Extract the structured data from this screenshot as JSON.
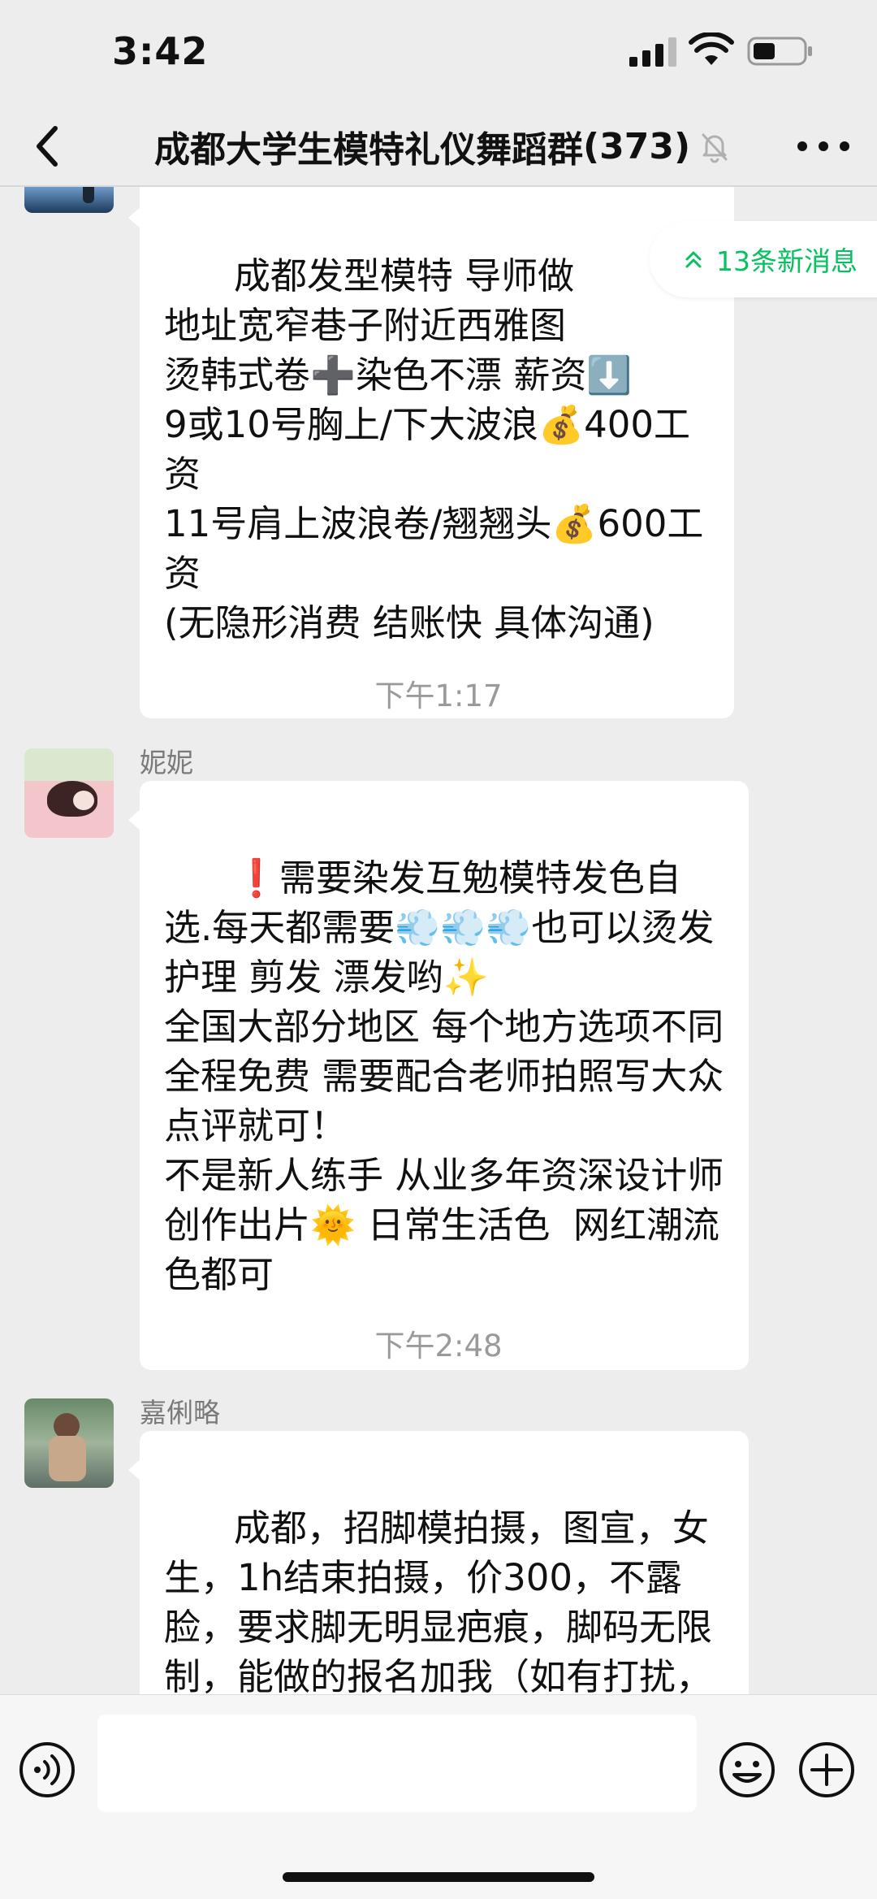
{
  "status_bar": {
    "time": "3:42"
  },
  "header": {
    "back_icon": "chevron-left-icon",
    "title": "成都大学生模特礼仪舞蹈群",
    "member_count": "(373)",
    "mute_icon": "bell-off-icon",
    "more_icon": "more-dots-icon"
  },
  "new_messages_pill": {
    "label": "13条新消息",
    "color": "#07c160"
  },
  "messages": [
    {
      "sender": "",
      "text": "成都发型模特 导师做\n地址宽窄巷子附近西雅图\n烫韩式卷➕染色不漂 薪资⬇️\n9或10号胸上/下大波浪💰400工资\n11号肩上波浪卷/翘翘头💰600工资\n(无隐形消费 结账快 具体沟通)"
    },
    {
      "timestamp": "下午1:17",
      "sender": "妮妮",
      "text": "❗需要染发互勉模特发色自选.每天都需要💨💨💨也可以烫发护理 剪发 漂发哟✨\n全国大部分地区 每个地方选项不同 全程免费 需要配合老师拍照写大众点评就可！\n不是新人练手 从业多年资深设计师创作出片🌞 日常生活色  网红潮流色都可"
    },
    {
      "timestamp": "下午2:48",
      "sender": "嘉俐略",
      "text": "成都，招脚模拍摄，图宣，女生，1h结束拍摄，价300，不露脸，要求脚无明显疤痕，脚码无限制，能做的报名加我（如有打扰，请踢，谢谢）"
    }
  ],
  "input_bar": {
    "voice_icon": "voice-icon",
    "emoji_icon": "emoji-icon",
    "plus_icon": "plus-icon",
    "text": ""
  }
}
